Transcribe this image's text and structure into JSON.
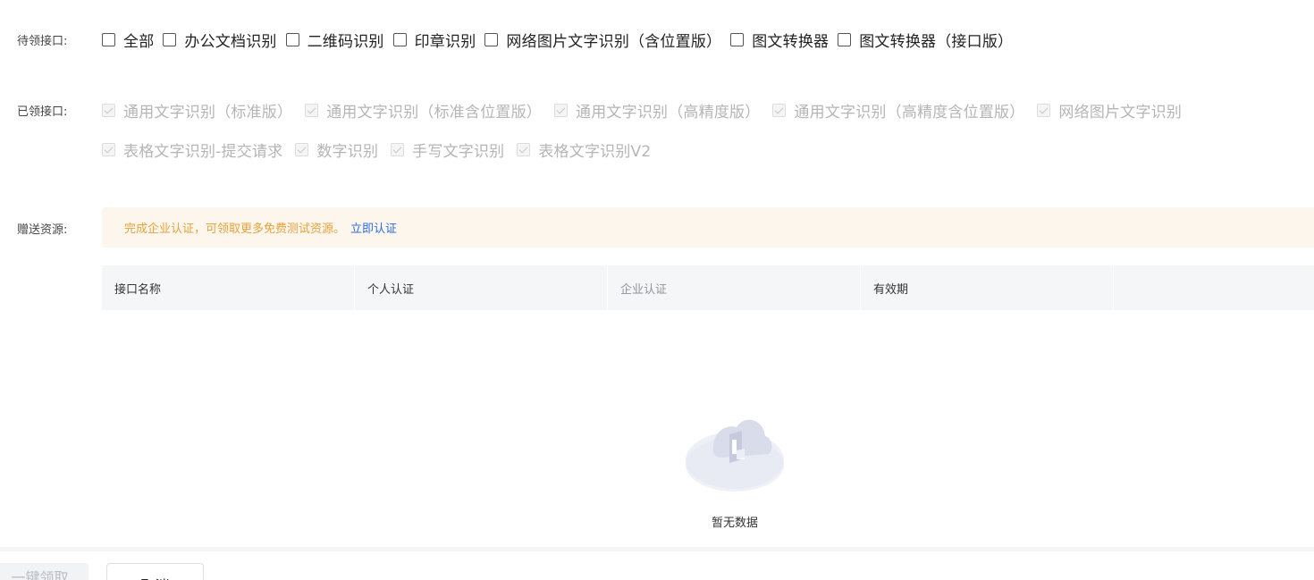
{
  "pending": {
    "label": "待领接口:",
    "items": [
      "全部",
      "办公文档识别",
      "二维码识别",
      "印章识别",
      "网络图片文字识别（含位置版）",
      "图文转换器",
      "图文转换器（接口版）"
    ]
  },
  "claimed": {
    "label": "已领接口:",
    "row1": [
      "通用文字识别（标准版）",
      "通用文字识别（标准含位置版）",
      "通用文字识别（高精度版）",
      "通用文字识别（高精度含位置版）",
      "网络图片文字识别"
    ],
    "row2": [
      "表格文字识别-提交请求",
      "数字识别",
      "手写文字识别",
      "表格文字识别V2"
    ]
  },
  "gift": {
    "label": "赠送资源:",
    "notice_text": "完成企业认证，可领取更多免费测试资源。",
    "notice_link": "立即认证"
  },
  "table": {
    "columns": [
      "接口名称",
      "个人认证",
      "企业认证",
      "有效期",
      ""
    ],
    "empty_text": "暂无数据"
  },
  "footer": {
    "claim_button": "一键领取",
    "cancel_button": "取消"
  },
  "colors": {
    "notice_bg": "#fdf6ec",
    "notice_text": "#e6a23c",
    "link": "#2d6cdf",
    "table_header_bg": "#f5f6f8"
  }
}
